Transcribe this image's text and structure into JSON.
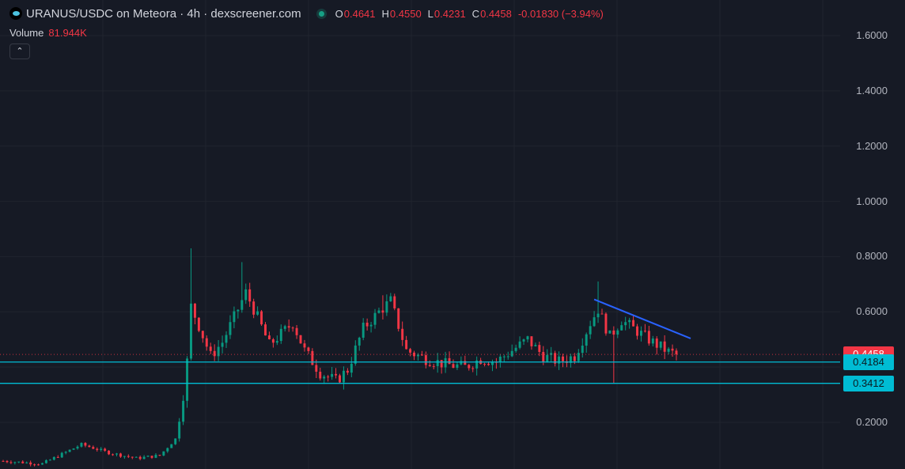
{
  "header": {
    "symbol_line": "URANUS/USDC on Meteora · 4h · dexscreener.com",
    "ohlc": [
      {
        "key": "O",
        "value": "0.4641"
      },
      {
        "key": "H",
        "value": "0.4550"
      },
      {
        "key": "L",
        "value": "0.4231"
      },
      {
        "key": "C",
        "value": "0.4458"
      }
    ],
    "change": "-0.01830 (−3.94%)"
  },
  "volume": {
    "label": "Volume",
    "value": "81.944K"
  },
  "collapse_icon": "chevron-up-icon",
  "colors": {
    "background": "#161a25",
    "up": "#089981",
    "down": "#f23645",
    "support_line": "#00bcd4",
    "trend_line": "#2962ff"
  },
  "chart_data": {
    "type": "candlestick",
    "y_axis": {
      "ticks": [
        "1.6000",
        "1.4000",
        "1.2000",
        "1.0000",
        "0.8000",
        "0.6000",
        "0.2000"
      ],
      "tick_values": [
        1.6,
        1.4,
        1.2,
        1.0,
        0.8,
        0.6,
        0.2
      ],
      "ylim": [
        0.0,
        1.72
      ]
    },
    "grid": true,
    "current_price": {
      "label": "0.4458",
      "value": 0.4458,
      "color": "#f23645"
    },
    "horizontal_levels": [
      {
        "label": "0.4184",
        "value": 0.4184,
        "color": "#00bcd4"
      },
      {
        "label": "0.3412",
        "value": 0.3412,
        "color": "#00bcd4"
      }
    ],
    "trendline": {
      "start": {
        "bar": 151,
        "price": 0.645
      },
      "end": {
        "bar": 172,
        "price": 0.495
      },
      "color": "#2962ff"
    },
    "path_anchors": [
      [
        0,
        0.06
      ],
      [
        10,
        0.05
      ],
      [
        20,
        0.12
      ],
      [
        27,
        0.09
      ],
      [
        34,
        0.07
      ],
      [
        40,
        0.08
      ],
      [
        44,
        0.14
      ],
      [
        46,
        0.3
      ],
      [
        47,
        0.42
      ],
      [
        48,
        0.62
      ],
      [
        50,
        0.55
      ],
      [
        53,
        0.44
      ],
      [
        56,
        0.49
      ],
      [
        59,
        0.58
      ],
      [
        62,
        0.67
      ],
      [
        65,
        0.58
      ],
      [
        68,
        0.48
      ],
      [
        71,
        0.52
      ],
      [
        74,
        0.56
      ],
      [
        77,
        0.46
      ],
      [
        81,
        0.38
      ],
      [
        85,
        0.35
      ],
      [
        88,
        0.39
      ],
      [
        92,
        0.54
      ],
      [
        96,
        0.6
      ],
      [
        99,
        0.64
      ],
      [
        103,
        0.46
      ],
      [
        108,
        0.43
      ],
      [
        113,
        0.41
      ],
      [
        118,
        0.4
      ],
      [
        122,
        0.43
      ],
      [
        126,
        0.42
      ],
      [
        130,
        0.46
      ],
      [
        134,
        0.5
      ],
      [
        138,
        0.44
      ],
      [
        142,
        0.42
      ],
      [
        146,
        0.44
      ],
      [
        150,
        0.56
      ],
      [
        152,
        0.61
      ],
      [
        155,
        0.51
      ],
      [
        158,
        0.57
      ],
      [
        162,
        0.53
      ],
      [
        166,
        0.49
      ],
      [
        170,
        0.455
      ],
      [
        172,
        0.4458
      ]
    ],
    "spikes": [
      {
        "bar": 48,
        "high": 0.83
      },
      {
        "bar": 61,
        "high": 0.78
      },
      {
        "bar": 97,
        "high": 0.66
      },
      {
        "bar": 152,
        "high": 0.71
      },
      {
        "bar": 156,
        "low": 0.34
      }
    ],
    "bar_count": 173
  }
}
